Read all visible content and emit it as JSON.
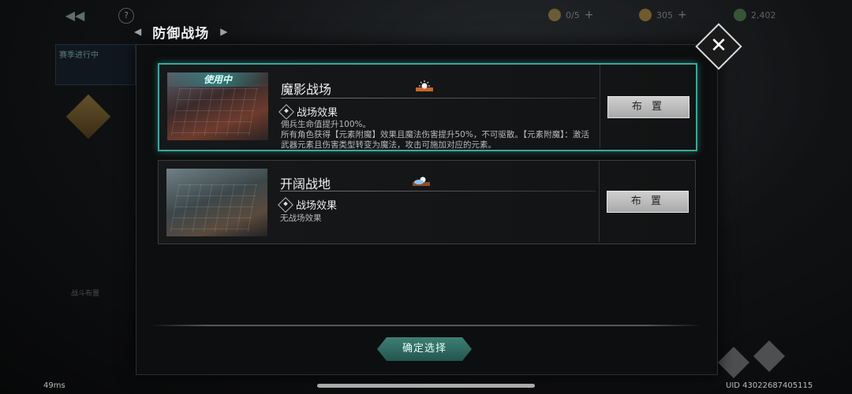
{
  "header": {
    "title": "防御战场",
    "resources": [
      {
        "value": "0/5"
      },
      {
        "value": "305"
      },
      {
        "value": "2,402"
      }
    ]
  },
  "background": {
    "side_panel_title": "赛季进行中",
    "left_label_1": "战斗布置"
  },
  "battlefields": [
    {
      "name": "魔影战场",
      "status": "使用中",
      "effect_title": "战场效果",
      "effect_text": "佣兵生命值提升100%。\n所有角色获得【元素附魔】效果且魔法伤害提升50%，不可驱散。【元素附魔】：激活武器元素且伤害类型转变为魔法，攻击可施加对应的元素。",
      "deploy_label": "布 置",
      "selected": true
    },
    {
      "name": "开阔战地",
      "effect_title": "战场效果",
      "effect_text": "无战场效果",
      "deploy_label": "布 置",
      "selected": false
    }
  ],
  "confirm_label": "确定选择",
  "footer": {
    "fps": "49ms",
    "uid": "UID 43022687405115"
  },
  "colors": {
    "accent": "#3aa79b",
    "button_gray": "#bdbdbd",
    "confirm": "#2f6b62"
  }
}
